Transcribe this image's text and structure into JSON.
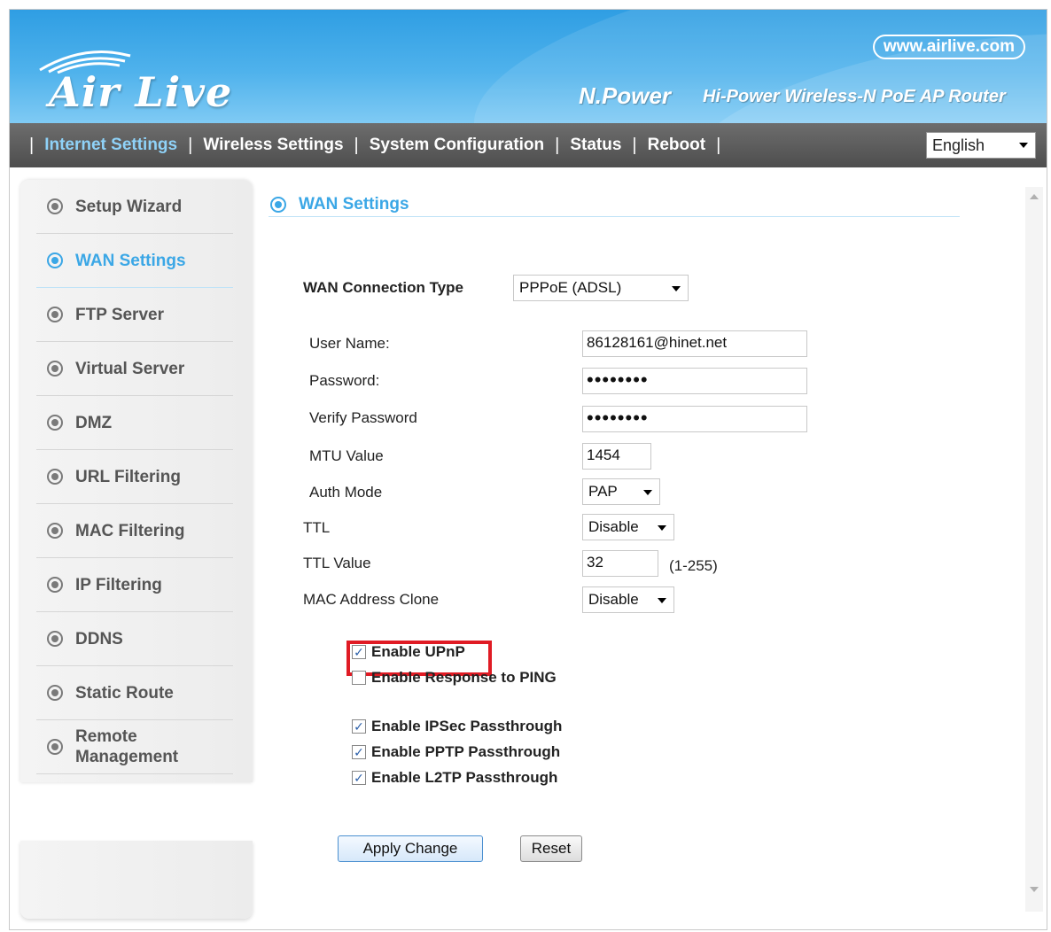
{
  "brand": {
    "logo_text": "Air Live",
    "url": "www.airlive.com",
    "product_line": "N.Power",
    "tagline": "Hi-Power Wireless-N PoE AP Router"
  },
  "nav": {
    "items": [
      {
        "label": "Internet Settings",
        "active": true
      },
      {
        "label": "Wireless Settings",
        "active": false
      },
      {
        "label": "System Configuration",
        "active": false
      },
      {
        "label": "Status",
        "active": false
      },
      {
        "label": "Reboot",
        "active": false
      }
    ],
    "language": "English"
  },
  "sidebar": {
    "items": [
      {
        "label": "Setup Wizard",
        "active": false
      },
      {
        "label": "WAN Settings",
        "active": true
      },
      {
        "label": "FTP Server",
        "active": false
      },
      {
        "label": "Virtual Server",
        "active": false
      },
      {
        "label": "DMZ",
        "active": false
      },
      {
        "label": "URL Filtering",
        "active": false
      },
      {
        "label": "MAC Filtering",
        "active": false
      },
      {
        "label": "IP Filtering",
        "active": false
      },
      {
        "label": "DDNS",
        "active": false
      },
      {
        "label": "Static Route",
        "active": false
      },
      {
        "label": "Remote\nManagement",
        "active": false
      }
    ]
  },
  "content": {
    "title": "WAN Settings",
    "connection_type": {
      "label": "WAN Connection Type",
      "value": "PPPoE (ADSL)"
    },
    "user_name": {
      "label": "User Name:",
      "value": "86128161@hinet.net"
    },
    "password": {
      "label": "Password:",
      "value": "••••••••"
    },
    "verify_password": {
      "label": "Verify Password",
      "value": "••••••••"
    },
    "mtu": {
      "label": "MTU Value",
      "value": "1454"
    },
    "auth_mode": {
      "label": "Auth Mode",
      "value": "PAP"
    },
    "ttl": {
      "label": "TTL",
      "value": "Disable"
    },
    "ttl_value": {
      "label": "TTL Value",
      "value": "32",
      "hint": "(1-255)"
    },
    "mac_clone": {
      "label": "MAC Address Clone",
      "value": "Disable"
    },
    "checkboxes": [
      {
        "label": "Enable UPnP",
        "checked": true
      },
      {
        "label": "Enable Response to PING",
        "checked": false
      },
      {
        "label": "Enable IPSec Passthrough",
        "checked": true
      },
      {
        "label": "Enable PPTP Passthrough",
        "checked": true
      },
      {
        "label": "Enable L2TP Passthrough",
        "checked": true
      }
    ],
    "apply_label": "Apply Change",
    "reset_label": "Reset"
  },
  "colors": {
    "accent": "#3ba7e6",
    "highlight": "#e01b24",
    "nav_bg": "#5a5a5a",
    "header_bg": "#3aa6e6"
  }
}
